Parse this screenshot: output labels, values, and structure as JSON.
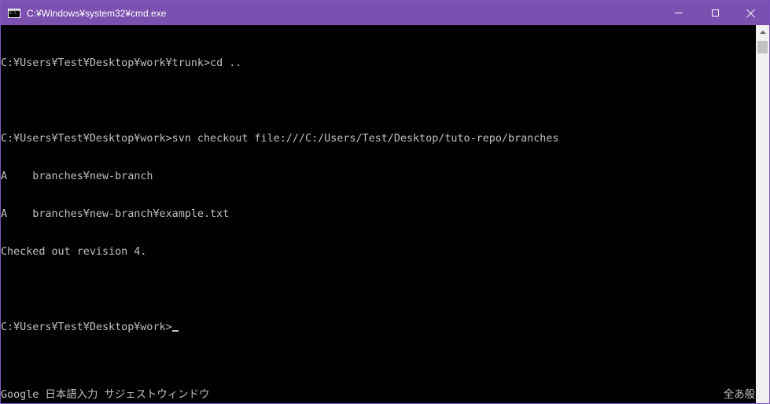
{
  "window": {
    "title": "C:¥Windows¥system32¥cmd.exe",
    "icon": "cmd-icon",
    "controls": {
      "minimize": "minimize-icon",
      "maximize": "maximize-icon",
      "close": "close-icon"
    }
  },
  "console": {
    "lines": [
      "C:¥Users¥Test¥Desktop¥work¥trunk>cd ..",
      "",
      "C:¥Users¥Test¥Desktop¥work>svn checkout file:///C:/Users/Test/Desktop/tuto-repo/branches",
      "A    branches¥new-branch",
      "A    branches¥new-branch¥example.txt",
      "Checked out revision 4.",
      "",
      "C:¥Users¥Test¥Desktop¥work>"
    ]
  },
  "ime": {
    "left": "Google 日本語入力 サジェストウィンドウ",
    "right": "全あ般"
  },
  "colors": {
    "titlebar": "#7b50b0",
    "console_bg": "#000000",
    "console_text": "#c0c0c0"
  }
}
